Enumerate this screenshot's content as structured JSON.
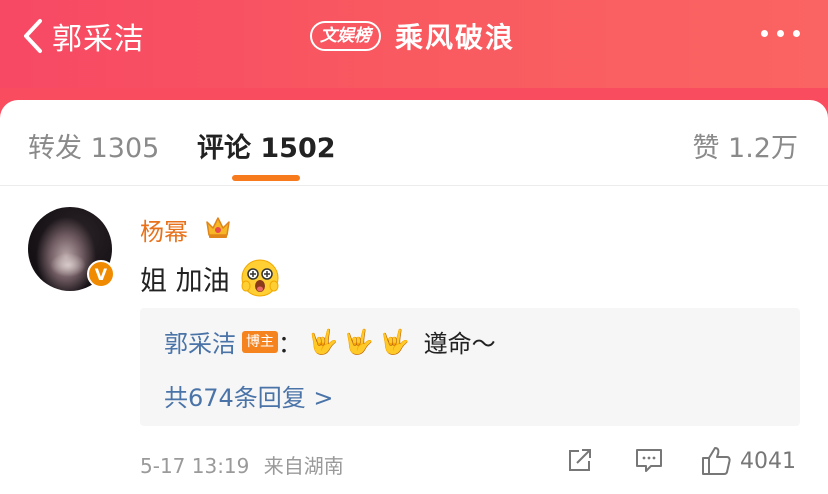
{
  "header": {
    "back_label": "郭采洁",
    "list_badge": "文娱榜",
    "title": "乘风破浪"
  },
  "tabs": {
    "forward": "转发 1305",
    "comments": "评论 1502",
    "likes": "赞 1.2万"
  },
  "comment": {
    "username": "杨幂",
    "verified_mark": "V",
    "text": "姐 加油",
    "reply": {
      "author": "郭采洁",
      "host_badge": "博主",
      "separator": "：",
      "hands": [
        "🤟",
        "🤟",
        "🤟"
      ],
      "text": "遵命～"
    },
    "more_replies": "共674条回复 >",
    "timestamp": "5-17 13:19",
    "source": "来自湖南",
    "like_count": "4041"
  },
  "colors": {
    "header_gradient_start": "#f74864",
    "header_gradient_end": "#fa6462",
    "accent_orange": "#f77a1c",
    "link_blue": "#4a73a8"
  },
  "icons": [
    "back-chevron-icon",
    "more-dots-icon",
    "crown-icon",
    "emoji-excited-face-icon",
    "share-icon",
    "reply-comment-icon",
    "thumbs-up-icon"
  ]
}
